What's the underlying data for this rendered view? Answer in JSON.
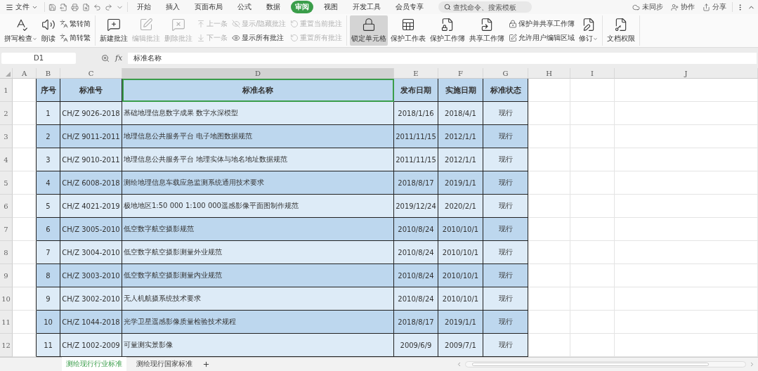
{
  "menu_bar": {
    "file_menu": "文件",
    "tabs": [
      {
        "label": "开始",
        "selected": false
      },
      {
        "label": "插入",
        "selected": false
      },
      {
        "label": "页面布局",
        "selected": false
      },
      {
        "label": "公式",
        "selected": false
      },
      {
        "label": "数据",
        "selected": false
      },
      {
        "label": "审阅",
        "selected": true
      },
      {
        "label": "视图",
        "selected": false
      },
      {
        "label": "开发工具",
        "selected": false
      },
      {
        "label": "会员专享",
        "selected": false
      }
    ],
    "search": {
      "placeholder": "查找命令、搜索模板"
    },
    "actions": [
      "未同步",
      "协作",
      "分享"
    ]
  },
  "ribbon": [
    {
      "columns": [
        {
          "kind": "large",
          "label": "拼写检查",
          "disabled": false,
          "pressed": false,
          "dropdown": true
        },
        {
          "kind": "large",
          "label": "朗读",
          "disabled": false,
          "pressed": false,
          "dropdown": false
        },
        {
          "kind": "stack",
          "items": [
            {
              "label": "繁转简",
              "disabled": false
            },
            {
              "label": "简转繁",
              "disabled": false
            }
          ]
        }
      ]
    },
    {
      "columns": [
        {
          "kind": "large",
          "label": "新建批注",
          "disabled": false,
          "pressed": false,
          "dropdown": false
        },
        {
          "kind": "large",
          "label": "编辑批注",
          "disabled": true,
          "pressed": false,
          "dropdown": false
        },
        {
          "kind": "large",
          "label": "删除批注",
          "disabled": true,
          "pressed": false,
          "dropdown": false
        },
        {
          "kind": "stack",
          "items": [
            {
              "label": "上一条",
              "disabled": true
            },
            {
              "label": "下一条",
              "disabled": true
            }
          ]
        },
        {
          "kind": "stack",
          "items": [
            {
              "label": "显示/隐藏批注",
              "disabled": true
            },
            {
              "label": "显示所有批注",
              "disabled": false
            }
          ]
        },
        {
          "kind": "stack",
          "items": [
            {
              "label": "重置当前批注",
              "disabled": true
            },
            {
              "label": "重置所有批注",
              "disabled": true
            }
          ]
        }
      ]
    },
    {
      "columns": [
        {
          "kind": "large",
          "label": "锁定单元格",
          "disabled": false,
          "pressed": true,
          "dropdown": false
        },
        {
          "kind": "large",
          "label": "保护工作表",
          "disabled": false,
          "pressed": false,
          "dropdown": false
        },
        {
          "kind": "large",
          "label": "保护工作簿",
          "disabled": false,
          "pressed": false,
          "dropdown": false
        },
        {
          "kind": "large",
          "label": "共享工作簿",
          "disabled": false,
          "pressed": false,
          "dropdown": false
        },
        {
          "kind": "stack",
          "items": [
            {
              "label": "保护并共享工作簿",
              "disabled": false
            },
            {
              "label": "允许用户编辑区域",
              "disabled": false
            }
          ]
        },
        {
          "kind": "large",
          "label": "修订",
          "disabled": false,
          "pressed": false,
          "dropdown": true
        }
      ]
    },
    {
      "columns": [
        {
          "kind": "large",
          "label": "文档权限",
          "disabled": false,
          "pressed": false,
          "dropdown": false
        }
      ]
    }
  ],
  "formula_bar": {
    "cell_ref": "D1",
    "function_label": "fx",
    "formula": "标准名称"
  },
  "columns": [
    {
      "label": "A",
      "selected": false
    },
    {
      "label": "B",
      "selected": false
    },
    {
      "label": "C",
      "selected": false
    },
    {
      "label": "D",
      "selected": true
    },
    {
      "label": "E",
      "selected": false
    },
    {
      "label": "F",
      "selected": false
    },
    {
      "label": "G",
      "selected": false
    },
    {
      "label": "H",
      "selected": false
    },
    {
      "label": "I",
      "selected": false
    },
    {
      "label": "J",
      "selected": false
    }
  ],
  "row_numbers": [
    "1",
    "2",
    "3",
    "4",
    "5",
    "6",
    "7",
    "8",
    "9",
    "10",
    "11",
    "12"
  ],
  "header_row": [
    "序号",
    "标准号",
    "标准名称",
    "发布日期",
    "实施日期",
    "标准状态"
  ],
  "rows": [
    [
      "1",
      "CH/Z 9026-2018",
      "基础地理信息数字成果 数字水深模型",
      "2018/1/16",
      "2018/4/1",
      "现行"
    ],
    [
      "2",
      "CH/Z 9011-2011",
      "地理信息公共服务平台 电子地图数据规范",
      "2011/11/15",
      "2012/1/1",
      "现行"
    ],
    [
      "3",
      "CH/Z 9010-2011",
      "地理信息公共服务平台 地理实体与地名地址数据规范",
      "2011/11/15",
      "2012/1/1",
      "现行"
    ],
    [
      "4",
      "CH/Z 6008-2018",
      "测绘地理信息车载应急监测系统通用技术要求",
      "2018/8/17",
      "2019/1/1",
      "现行"
    ],
    [
      "5",
      "CH/Z 4021-2019",
      "极地地区1:50 000 1:100 000遥感影像平面图制作规范",
      "2019/12/24",
      "2020/2/1",
      "现行"
    ],
    [
      "6",
      "CH/Z 3005-2010",
      "低空数字航空摄影规范",
      "2010/8/24",
      "2010/10/1",
      "现行"
    ],
    [
      "7",
      "CH/Z 3004-2010",
      "低空数字航空摄影测量外业规范",
      "2010/8/24",
      "2010/10/1",
      "现行"
    ],
    [
      "8",
      "CH/Z 3003-2010",
      "低空数字航空摄影测量内业规范",
      "2010/8/24",
      "2010/10/1",
      "现行"
    ],
    [
      "9",
      "CH/Z 3002-2010",
      "无人机航摄系统技术要求",
      "2010/8/24",
      "2010/10/1",
      "现行"
    ],
    [
      "10",
      "CH/Z 1044-2018",
      "光学卫星遥感影像质量检验技术规程",
      "2018/8/17",
      "2019/1/1",
      "现行"
    ],
    [
      "11",
      "CH/Z 1002-2009",
      "可量测实景影像",
      "2009/6/9",
      "2009/7/1",
      "现行"
    ]
  ],
  "sheet_tabs": [
    {
      "label": "测绘现行行业标准",
      "selected": true
    },
    {
      "label": "测绘现行国家标准",
      "selected": false
    }
  ]
}
